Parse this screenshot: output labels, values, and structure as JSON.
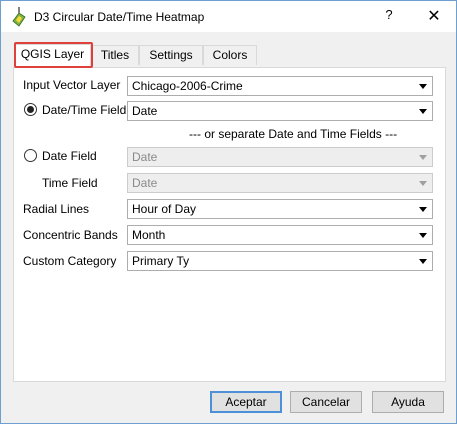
{
  "window": {
    "title": "D3 Circular Date/Time Heatmap",
    "help_glyph": "?",
    "close_glyph": "✕"
  },
  "tabs": [
    {
      "label": "QGIS Layer",
      "active": true
    },
    {
      "label": "Titles",
      "active": false
    },
    {
      "label": "Settings",
      "active": false
    },
    {
      "label": "Colors",
      "active": false
    }
  ],
  "form": {
    "input_layer": {
      "label": "Input Vector Layer",
      "value": "Chicago-2006-Crime"
    },
    "datetime_field": {
      "label": "Date/Time Field",
      "value": "Date",
      "selected": true
    },
    "separator_text": "--- or separate Date and Time Fields ---",
    "date_field": {
      "label": "Date Field",
      "value": "Date",
      "selected": false,
      "enabled": false
    },
    "time_field": {
      "label": "Time Field",
      "value": "Date",
      "enabled": false
    },
    "radial_lines": {
      "label": "Radial Lines",
      "value": "Hour of Day"
    },
    "concentric_bands": {
      "label": "Concentric Bands",
      "value": "Month"
    },
    "custom_category": {
      "label": "Custom Category",
      "value": "Primary Ty"
    }
  },
  "buttons": {
    "accept": "Aceptar",
    "cancel": "Cancelar",
    "help": "Ayuda"
  },
  "colors": {
    "highlight": "#e0403a",
    "default_button_border": "#4d90d8"
  }
}
